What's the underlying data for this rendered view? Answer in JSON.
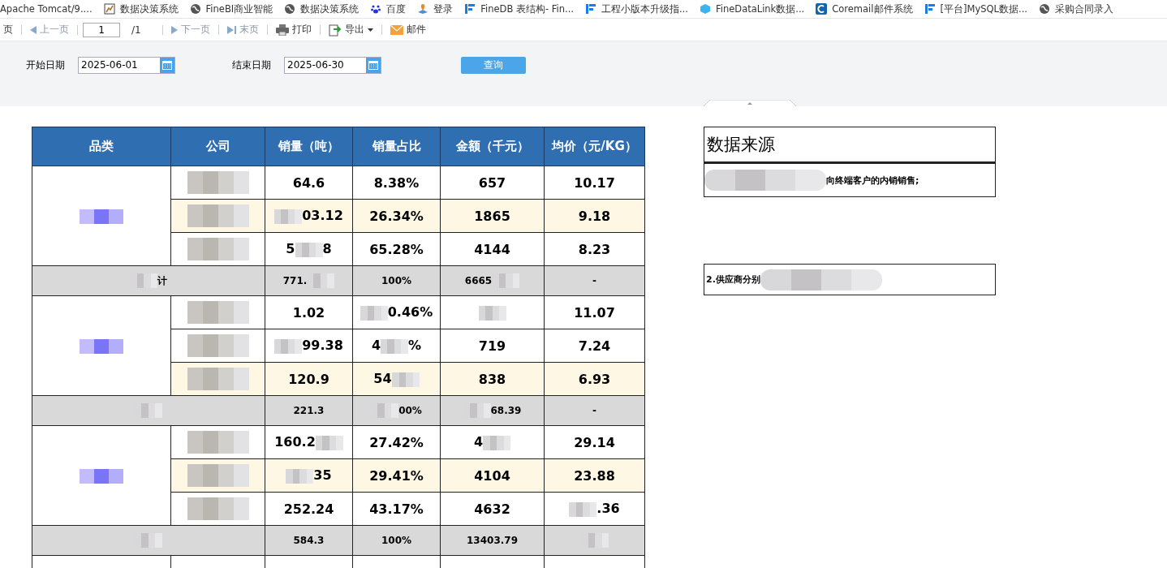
{
  "bookmarks": [
    "Apache Tomcat/9....",
    "数据决策系统",
    "FineBI商业智能",
    "数据决策系统",
    "百度",
    "登录",
    "FineDB 表结构- Fin...",
    "工程小版本升级指...",
    "FineDataLink数据...",
    "Coremail邮件系统",
    "[平台]MySQL数据...",
    "采购合同录入"
  ],
  "toolbar": {
    "first": "页",
    "prev": "上一页",
    "page": "1",
    "total": "/1",
    "next": "下一页",
    "last": "末页",
    "print": "打印",
    "export": "导出",
    "mail": "邮件"
  },
  "filters": {
    "start_label": "开始日期",
    "start_value": "2025-06-01",
    "end_label": "结束日期",
    "end_value": "2025-06-30",
    "query": "查询"
  },
  "table": {
    "columns": [
      "品类",
      "公司",
      "销量（吨）",
      "销量占比",
      "金额（千元）",
      "均价（元/KG）"
    ],
    "groups": [
      {
        "rows": [
          {
            "highlight": false,
            "cells": [
              [
                "64.6"
              ],
              [
                "8.38%"
              ],
              [
                "657"
              ],
              [
                "10.17"
              ]
            ]
          },
          {
            "highlight": true,
            "cells": [
              [
                {
                  "kind": "redacted"
                },
                "03.12"
              ],
              [
                "26.34%"
              ],
              [
                "1865"
              ],
              [
                "9.18"
              ]
            ]
          },
          {
            "highlight": false,
            "cells": [
              [
                "5",
                {
                  "kind": "redacted"
                },
                "8"
              ],
              [
                "65.28%"
              ],
              [
                "4144"
              ],
              [
                "8.23"
              ]
            ]
          }
        ],
        "subtotal": {
          "label": [
            {
              "kind": "redacted"
            },
            "计"
          ],
          "cells": [
            [
              "771.",
              {
                "kind": "redacted"
              }
            ],
            [
              "100%"
            ],
            [
              "6665",
              {
                "kind": "redacted"
              }
            ],
            [
              "-"
            ]
          ]
        }
      },
      {
        "rows": [
          {
            "highlight": false,
            "cells": [
              [
                "1.02"
              ],
              [
                {
                  "kind": "redacted"
                },
                "0.46%"
              ],
              [
                {
                  "kind": "redacted"
                }
              ],
              [
                "11.07"
              ]
            ]
          },
          {
            "highlight": false,
            "cells": [
              [
                {
                  "kind": "redacted"
                },
                "99.38"
              ],
              [
                "4",
                {
                  "kind": "redacted"
                },
                "%"
              ],
              [
                "719"
              ],
              [
                "7.24"
              ]
            ]
          },
          {
            "highlight": true,
            "cells": [
              [
                "120.9"
              ],
              [
                "54",
                {
                  "kind": "redacted"
                }
              ],
              [
                "838"
              ],
              [
                "6.93"
              ]
            ]
          }
        ],
        "subtotal": {
          "label": [
            {
              "kind": "redacted"
            }
          ],
          "cells": [
            [
              "221.3"
            ],
            [
              {
                "kind": "redacted"
              },
              "00%"
            ],
            [
              {
                "kind": "redacted"
              },
              "68.39"
            ],
            [
              "-"
            ]
          ]
        }
      },
      {
        "rows": [
          {
            "highlight": false,
            "cells": [
              [
                "160.2",
                {
                  "kind": "redacted"
                }
              ],
              [
                "27.42%"
              ],
              [
                "4",
                {
                  "kind": "redacted"
                }
              ],
              [
                "29.14"
              ]
            ]
          },
          {
            "highlight": true,
            "cells": [
              [
                {
                  "kind": "redacted"
                },
                "35"
              ],
              [
                "29.41%"
              ],
              [
                "4104"
              ],
              [
                "23.88"
              ]
            ]
          },
          {
            "highlight": false,
            "cells": [
              [
                "252.24"
              ],
              [
                "43.17%"
              ],
              [
                "4632"
              ],
              [
                {
                  "kind": "redacted"
                },
                ".36"
              ]
            ]
          }
        ],
        "subtotal": {
          "label": [
            {
              "kind": "redacted"
            }
          ],
          "cells": [
            [
              "584.3"
            ],
            [
              "100%"
            ],
            [
              "13403.79"
            ],
            [
              {
                "kind": "redacted"
              }
            ]
          ]
        }
      }
    ]
  },
  "notes": {
    "title": "数据来源",
    "items": [
      [
        {
          "kind": "redacted"
        },
        "向终端客户的内销销售;"
      ],
      [
        "2.供应商分别",
        {
          "kind": "redacted"
        }
      ]
    ]
  }
}
